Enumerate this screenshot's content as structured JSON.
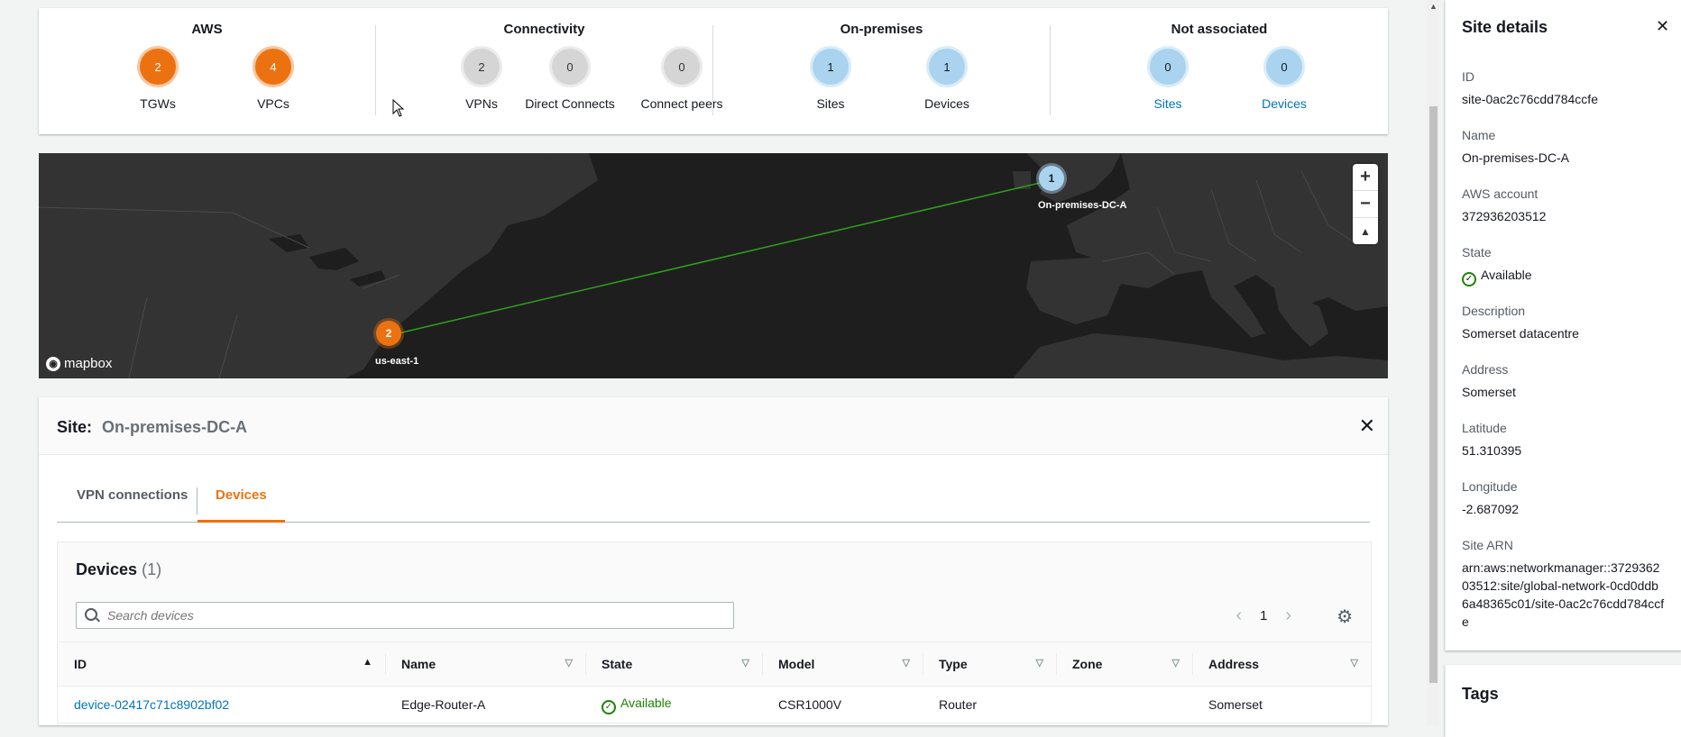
{
  "summary": {
    "groups": [
      {
        "title": "AWS",
        "stats": [
          {
            "value": "2",
            "label": "TGWs"
          },
          {
            "value": "4",
            "label": "VPCs"
          }
        ]
      },
      {
        "title": "Connectivity",
        "stats": [
          {
            "value": "2",
            "label": "VPNs"
          },
          {
            "value": "0",
            "label": "Direct Connects"
          },
          {
            "value": "0",
            "label": "Connect peers"
          }
        ]
      },
      {
        "title": "On-premises",
        "stats": [
          {
            "value": "1",
            "label": "Sites"
          },
          {
            "value": "1",
            "label": "Devices"
          }
        ]
      },
      {
        "title": "Not associated",
        "stats": [
          {
            "value": "0",
            "label": "Sites"
          },
          {
            "value": "0",
            "label": "Devices"
          }
        ]
      }
    ]
  },
  "map": {
    "marker_region": {
      "count": "2",
      "label": "us-east-1"
    },
    "marker_site": {
      "count": "1",
      "label": "On-premises-DC-A"
    },
    "brand": "mapbox",
    "zoom_in": "+",
    "zoom_out": "−",
    "compass": "▲"
  },
  "site_panel": {
    "title_label": "Site:",
    "title_value": "On-premises-DC-A",
    "tabs": [
      {
        "label": "VPN connections"
      },
      {
        "label": "Devices"
      }
    ],
    "devices": {
      "title": "Devices",
      "count": "(1)",
      "search_placeholder": "Search devices",
      "page": "1",
      "columns": [
        "ID",
        "Name",
        "State",
        "Model",
        "Type",
        "Zone",
        "Address"
      ],
      "rows": [
        {
          "id": "device-02417c71c8902bf02",
          "name": "Edge-Router-A",
          "state": "Available",
          "model": "CSR1000V",
          "type": "Router",
          "zone": "",
          "address": "Somerset"
        }
      ]
    }
  },
  "details": {
    "title": "Site details",
    "fields": [
      {
        "label": "ID",
        "value": "site-0ac2c76cdd784ccfe"
      },
      {
        "label": "Name",
        "value": "On-premises-DC-A"
      },
      {
        "label": "AWS account",
        "value": "372936203512"
      },
      {
        "label": "State",
        "value": "Available"
      },
      {
        "label": "Description",
        "value": "Somerset datacentre"
      },
      {
        "label": "Address",
        "value": "Somerset"
      },
      {
        "label": "Latitude",
        "value": "51.310395"
      },
      {
        "label": "Longitude",
        "value": "-2.687092"
      },
      {
        "label": "Site ARN",
        "value": "arn:aws:networkmanager::372936203512:site/global-network-0cd0ddb6a48365c01/site-0ac2c76cdd784ccfe"
      }
    ]
  },
  "tags": {
    "title": "Tags"
  },
  "colors": {
    "orange": "#ec7211",
    "link": "#0073bb",
    "success": "#1d8102"
  }
}
